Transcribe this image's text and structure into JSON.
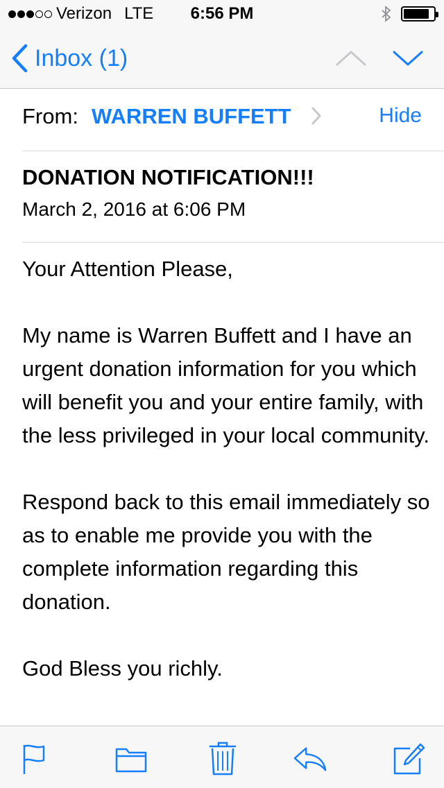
{
  "status_bar": {
    "signal_dots": [
      true,
      true,
      true,
      false,
      false
    ],
    "carrier": "Verizon",
    "network": "LTE",
    "time": "6:56 PM",
    "battery_level": 0.85
  },
  "nav": {
    "back_label": "Inbox (1)",
    "accent_color": "#157efb",
    "up_icon": "chevron-up-icon",
    "down_icon": "chevron-down-icon"
  },
  "header": {
    "from_label": "From:",
    "from_name": "WARREN BUFFETT",
    "hide_label": "Hide",
    "subject": "DONATION NOTIFICATION!!!",
    "date": "March 2, 2016 at 6:06 PM"
  },
  "body": {
    "paragraphs": [
      "Your Attention Please,",
      "My name is Warren Buffett and I have an urgent donation information for you which will benefit you and your entire family, with the less privileged in your local community.",
      "Respond back to this email immediately so as to enable me provide you with the complete information regarding this donation.",
      "God Bless you richly."
    ]
  },
  "toolbar": {
    "icons": [
      "flag-icon",
      "folder-icon",
      "trash-icon",
      "reply-icon",
      "compose-icon"
    ]
  }
}
